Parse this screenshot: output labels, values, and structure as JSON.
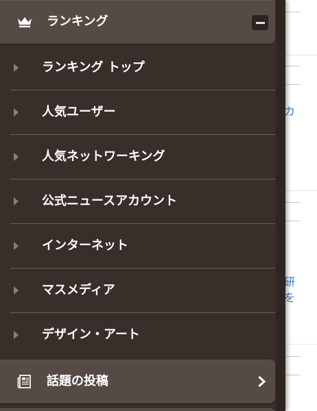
{
  "ranking_section": {
    "title": "ランキング",
    "icon": "crown-icon",
    "toggle": "collapse"
  },
  "ranking_items": [
    {
      "label": "ランキング トップ"
    },
    {
      "label": "人気ユーザー"
    },
    {
      "label": "人気ネットワーキング"
    },
    {
      "label": "公式ニュースアカウント"
    },
    {
      "label": "インターネット"
    },
    {
      "label": "マスメディア"
    },
    {
      "label": "デザイン・アート"
    }
  ],
  "topics_section": {
    "title": "話題の投稿",
    "icon": "newspaper-icon"
  },
  "background_page": {
    "snippet_1": "カ",
    "snippet_2": "研",
    "snippet_3": "を"
  },
  "colors": {
    "drawer_bg": "#3a2e2a",
    "header_bg": "#564a44",
    "link_blue": "#3a7bbf"
  }
}
